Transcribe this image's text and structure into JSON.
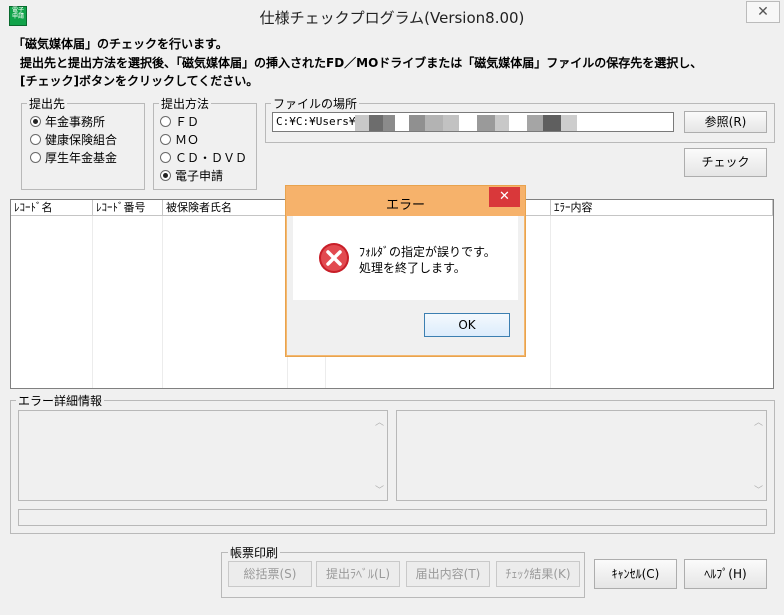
{
  "window": {
    "title": "仕様チェックプログラム(Version8.00)",
    "app_icon_text": "電子申請",
    "close_glyph": "✕"
  },
  "instructions": {
    "line1": "「磁気媒体届」のチェックを行います。",
    "line2": "提出先と提出方法を選択後、「磁気媒体届」の挿入されたFD／MOドライブまたは「磁気媒体届」ファイルの保存先を選択し、",
    "line3": "[チェック]ボタンをクリックしてください。"
  },
  "submit_to": {
    "legend": "提出先",
    "options": [
      "年金事務所",
      "健康保険組合",
      "厚生年金基金"
    ],
    "selected_index": 0
  },
  "submit_method": {
    "legend": "提出方法",
    "options": [
      "ＦＤ",
      "ＭＯ",
      "ＣＤ・ＤＶＤ",
      "電子申請"
    ],
    "selected_index": 3
  },
  "file_location": {
    "legend": "ファイルの場所",
    "value": "C:¥C:¥Users¥",
    "browse_label": "参照(R)"
  },
  "check_button_label": "チェック",
  "table": {
    "columns": [
      "ﾚｺｰﾄﾞ名",
      "ﾚｺｰﾄﾞ番号",
      "被保険者氏名",
      "",
      "",
      "ｴﾗｰ内容"
    ]
  },
  "error_detail": {
    "legend": "エラー詳細情報"
  },
  "print_group": {
    "legend": "帳票印刷",
    "buttons": [
      "総括票(S)",
      "提出ﾗﾍﾞﾙ(L)",
      "届出内容(T)",
      "ﾁｪｯｸ結果(K)"
    ]
  },
  "cancel_label": "ｷｬﾝｾﾙ(C)",
  "help_label": "ﾍﾙﾌﾟ(H)",
  "dialog": {
    "title": "エラー",
    "close_glyph": "✕",
    "message_line1": "ﾌｫﾙﾀﾞの指定が誤りです。",
    "message_line2": "処理を終了します。",
    "ok_label": "OK",
    "colors": {
      "title_bar": "#f6b26b",
      "close_button": "#d9383a",
      "error_icon": "#d9363e"
    }
  }
}
